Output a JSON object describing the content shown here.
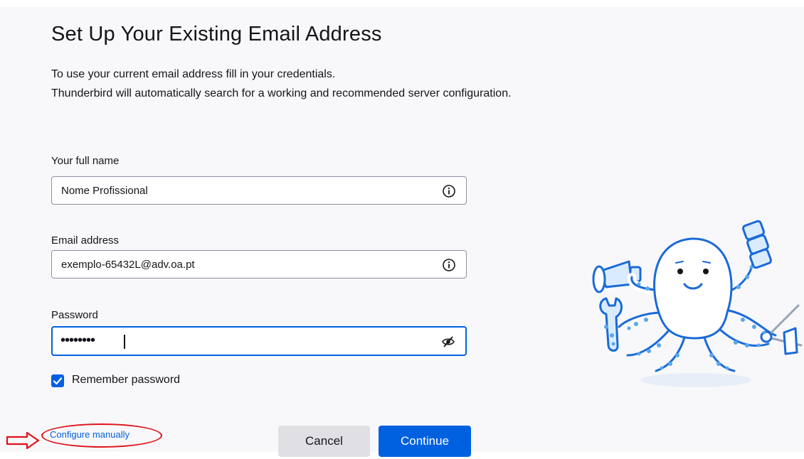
{
  "header": {
    "title": "Set Up Your Existing Email Address",
    "description_line1": "To use your current email address fill in your credentials.",
    "description_line2": "Thunderbird will automatically search for a working and recommended server configuration."
  },
  "form": {
    "full_name": {
      "label": "Your full name",
      "value": "Nome Profissional",
      "icon": "info-icon"
    },
    "email": {
      "label": "Email address",
      "value": "exemplo-65432L@adv.oa.pt",
      "icon": "info-icon"
    },
    "password": {
      "label": "Password",
      "masked_value": "••••••••",
      "icon": "eye-slash-icon"
    },
    "remember": {
      "label": "Remember password",
      "checked": true
    }
  },
  "actions": {
    "configure_manually": "Configure manually",
    "cancel": "Cancel",
    "continue": "Continue"
  },
  "colors": {
    "accent": "#0061e0",
    "annotation": "#e0121b",
    "mascot_line": "#1a6ad8",
    "mascot_fill": "#d9ecff"
  }
}
